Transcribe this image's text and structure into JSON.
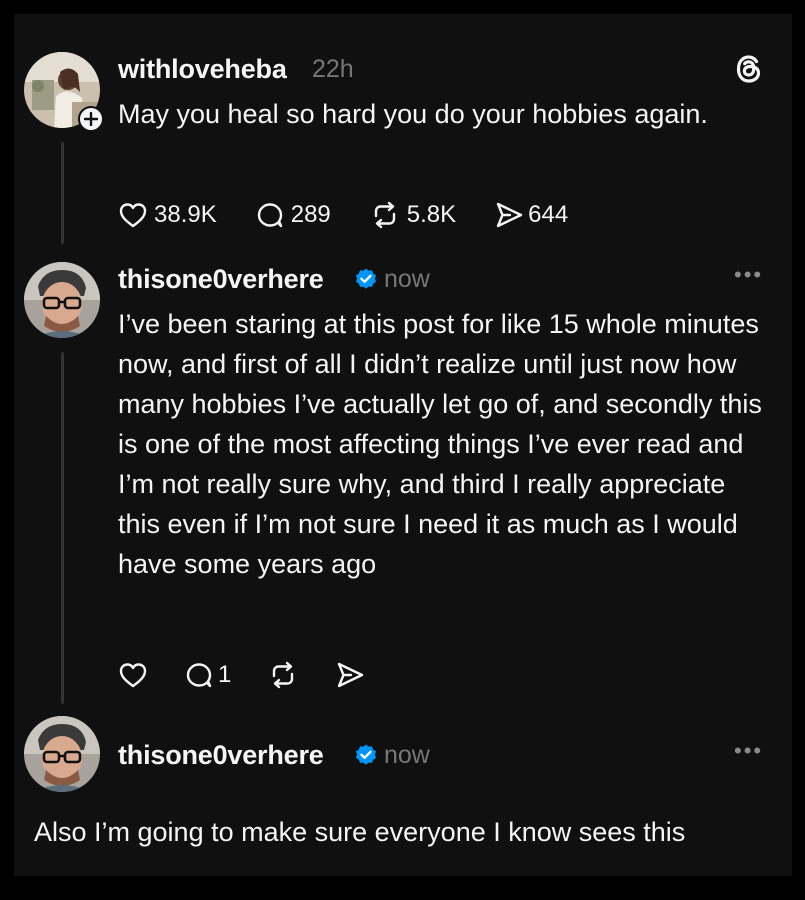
{
  "posts": [
    {
      "username": "withloveheba",
      "time": "22h",
      "text": "May you heal so hard you do your hobbies again.",
      "likes": "38.9K",
      "replies": "289",
      "reposts": "5.8K",
      "shares": "644"
    },
    {
      "username": "thisone0verhere",
      "time": "now",
      "text": "I’ve been staring at this post for like 15 whole minutes now, and first of all I didn’t realize until just now how many hobbies I’ve actually let go of, and secondly this is one of the most affecting things I’ve ever read and I’m not really sure why, and third I really appreciate this even if I’m not sure I need it as much as I would have some years ago",
      "replies": "1"
    },
    {
      "username": "thisone0verhere",
      "time": "now",
      "text": "Also I’m going to make sure everyone I know sees this"
    }
  ],
  "more_label": "•••",
  "icons": {
    "app_logo": "threads-logo-icon",
    "like": "heart-icon",
    "reply": "comment-icon",
    "repost": "repost-icon",
    "share": "send-icon",
    "verified": "verified-badge-icon",
    "follow": "plus-icon"
  },
  "colors": {
    "background": "#101010",
    "text": "#f3f5f7",
    "muted": "#777777",
    "verified": "#0095f6"
  }
}
